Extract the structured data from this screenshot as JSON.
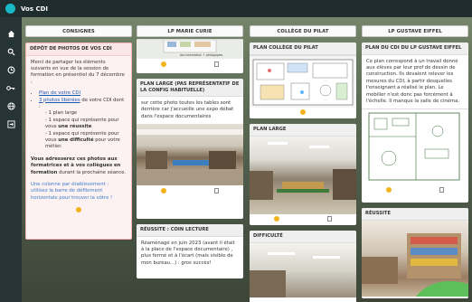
{
  "app": {
    "title": "Vos CDI"
  },
  "rail": {
    "icons": [
      "home-icon",
      "search-icon",
      "clock-icon",
      "key-icon",
      "globe-icon",
      "exit-icon"
    ]
  },
  "columns": [
    {
      "title": "CONSIGNES"
    },
    {
      "title": "LP MARIE CURIE"
    },
    {
      "title": "COLLÈGE DU PILAT"
    },
    {
      "title": "LP GUSTAVE EIFFEL"
    }
  ],
  "consignes": {
    "card_title": "DÉPÔT DE PHOTOS DE VOS CDI",
    "intro": "Merci de partager les éléments suivants en vue de la session de formation en présentiel du 7 décembre :",
    "list1": "Plan de votre CDI",
    "list2_link": "3 photos libérées",
    "list2_rest": " de votre CDI dont :",
    "sub1": "- 1 plan large",
    "sub2a": "- 1 espace qui représente pour vous ",
    "sub2b": "une réussite",
    "sub3a": "- 1 espace qui représente pour vous ",
    "sub3b": "une difficulté",
    "sub3c": " pour votre métier.",
    "para2a": "Vous adresserez ces photos aux formatrices et à vos collègues en formation",
    "para2b": " durant la prochaine séance.",
    "para3": "Une colonne par établissement : utilisez la barre de défilement horizontale pour trouver la vôtre !"
  },
  "marie": {
    "plan_caption": "documentation + pédagogies",
    "card2_title": "PLAN LARGE (PAS REPRÉSENTATIF DE LA CONFIG HABITUELLE)",
    "card2_body": "sur cette photo toutes les tables sont derrière car j'accueille une expo débat dans l'espace documentaires",
    "card3_title": "RÉUSSITE : COIN LECTURE",
    "card3_body": "Réaménagé en juin 2023 (avant il était à la place de l'espace documentaire) , plus fermé et à l'écart (mais visible de mon bureau...) : gros succès!"
  },
  "pilat": {
    "card1_title": "PLAN COLLÈGE DU PILAT",
    "card2_title": "PLAN LARGE",
    "card3_title": "DIFFICULTÉ"
  },
  "eiffel": {
    "card1_title": "PLAN DU CDI DU LP GUSTAVE EIFFEL",
    "card1_body": "Ce plan correspond à un travail donné aux élèves par leur prof de dessin de construction. Ils devaient relever les mesures du CDI, à partir desquelles l'enseignant a réalisé le plan. Le mobilier n'est donc pas forcément à l'échelle. Il manque la salle de cinéma.",
    "card2_title": "RÉUSSITE"
  },
  "colors": {
    "dot": "#f2b21c",
    "topbar": "#1f2d2f",
    "logo": "#19b9c8",
    "highlight_border": "#f5b5b5"
  }
}
